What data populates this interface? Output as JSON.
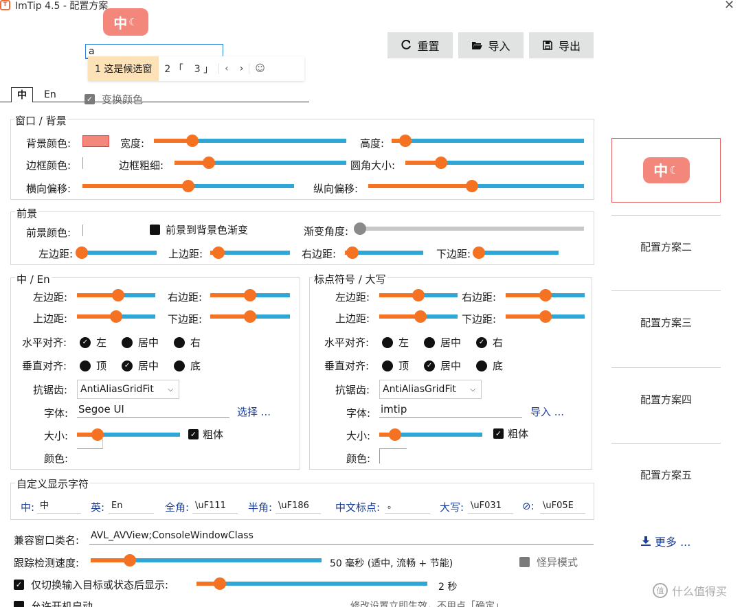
{
  "window": {
    "title": "ImTip 4.5 - 配置方案",
    "icon_text": "T",
    "close_glyph": "✕"
  },
  "preview_badge": {
    "text": "中",
    "moon_glyph": "☾"
  },
  "toolbar": {
    "reset_label": "重置",
    "import_label": "导入",
    "export_label": "导出"
  },
  "candidate": {
    "input_value": "a",
    "items": [
      "1 这是候选窗",
      "2 「",
      "3 」"
    ],
    "prev": "‹",
    "next": "›",
    "emoji": "☺"
  },
  "tabs": {
    "zh": "中",
    "en": "En"
  },
  "invert_color": {
    "label": "变换颜色",
    "checked": true
  },
  "window_group": {
    "legend": "窗口 / 背景",
    "bg_color_label": "背景颜色:",
    "bg_color": "#f4877b",
    "width_label": "宽度:",
    "width_value": 0.2,
    "height_label": "高度:",
    "height_value": 0.07,
    "border_color_label": "边框颜色:",
    "border_width_label": "边框粗细:",
    "border_width_value": 0.2,
    "radius_label": "圆角大小:",
    "radius_value": 0.2,
    "x_offset_label": "横向偏移:",
    "x_offset_value": 0.5,
    "y_offset_label": "纵向偏移:",
    "y_offset_value": 0.48
  },
  "fg_group": {
    "legend": "前景",
    "fg_color_label": "前景颜色:",
    "gradient_label": "前景到背景色渐变",
    "gradient_checked": false,
    "angle_label": "渐变角度:",
    "angle_value": 0.0,
    "left_label": "左边距:",
    "left_value": 0.03,
    "top_label": "上边距:",
    "top_value": 0.1,
    "right_label": "右边距:",
    "right_value": 0.1,
    "bottom_label": "下边距:",
    "bottom_value": 0.0
  },
  "zh_group": {
    "legend": "中 / En",
    "left_label": "左边距:",
    "left_value": 0.53,
    "right_label": "右边距:",
    "right_value": 0.5,
    "top_label": "上边距:",
    "top_value": 0.5,
    "bottom_label": "下边距:",
    "bottom_value": 0.5,
    "halign_label": "水平对齐:",
    "halign_options": [
      "左",
      "居中",
      "右"
    ],
    "halign_selected": 0,
    "valign_label": "垂直对齐:",
    "valign_options": [
      "顶",
      "居中",
      "底"
    ],
    "valign_selected": 1,
    "aa_label": "抗锯齿:",
    "aa_value": "AntiAliasGridFit",
    "font_label": "字体:",
    "font_value": "Segoe UI",
    "font_action": "选择 ...",
    "size_label": "大小:",
    "size_value": 0.2,
    "bold_label": "粗体",
    "bold_checked": true,
    "color_label": "颜色:"
  },
  "punct_group": {
    "legend": "标点符号 / 大写",
    "left_label": "左边距:",
    "left_value": 0.5,
    "right_label": "右边距:",
    "right_value": 0.5,
    "top_label": "上边距:",
    "top_value": 0.53,
    "bottom_label": "下边距:",
    "bottom_value": 0.5,
    "halign_label": "水平对齐:",
    "halign_options": [
      "左",
      "居中",
      "右"
    ],
    "halign_selected": 2,
    "valign_label": "垂直对齐:",
    "valign_options": [
      "顶",
      "居中",
      "底"
    ],
    "valign_selected": 1,
    "aa_label": "抗锯齿:",
    "aa_value": "AntiAliasGridFit",
    "font_label": "字体:",
    "font_value": "imtip",
    "font_action": "导入 ...",
    "size_label": "大小:",
    "size_value": 0.15,
    "bold_label": "粗体",
    "bold_checked": true,
    "color_label": "颜色:"
  },
  "custom_chars": {
    "legend": "自定义显示字符",
    "zh_label": "中:",
    "zh_value": "中",
    "en_label": "英:",
    "en_value": "En",
    "full_label": "全角:",
    "full_value": "\\uF111",
    "half_label": "半角:",
    "half_value": "\\uF186",
    "punct_label": "中文标点:",
    "punct_value": "。",
    "caps_label": "大写:",
    "caps_value": "\\uF031",
    "off_label": "⊘:",
    "off_value": "\\uF05E"
  },
  "compat": {
    "label": "兼容窗口类名:",
    "value": "AVL_AVView;ConsoleWindowClass"
  },
  "tracking": {
    "label": "跟踪检测速度:",
    "value": 0.17,
    "value_text": "50 毫秒 (适中, 流畅 + 节能)",
    "weird_mode_label": "怪异模式",
    "weird_mode_checked": false
  },
  "switch_only": {
    "label": "仅切换输入目标或状态后显示:",
    "checked": true,
    "value": 0.1,
    "value_text": "2 秒"
  },
  "autostart": {
    "label": "允许开机启动",
    "checked": false
  },
  "footer": {
    "hint": "修改设置立即生效，不用点「确定」"
  },
  "sidebar": {
    "items": [
      "配置方案二",
      "配置方案三",
      "配置方案四",
      "配置方案五"
    ],
    "more": "更多 ..."
  },
  "watermark": {
    "text": "什么值得买",
    "logo": "值"
  }
}
